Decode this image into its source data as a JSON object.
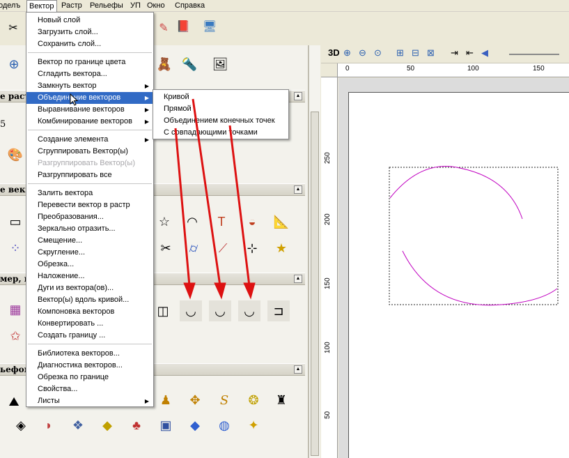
{
  "menubar": {
    "items": [
      "оделъ",
      "Вектор",
      "Растр",
      "Рельефы",
      "УП",
      "Окно",
      "Справка"
    ]
  },
  "vector_menu": {
    "items": [
      {
        "label": "Новый слой"
      },
      {
        "label": "Загрузить слой..."
      },
      {
        "label": "Сохранить слой..."
      },
      {
        "label": "Вектор по границе цвета"
      },
      {
        "label": "Сгладить вектора..."
      },
      {
        "label": "Замкнуть вектор"
      },
      {
        "label": "Объединение векторов",
        "highlighted": true
      },
      {
        "label": "Выравнивание векторов"
      },
      {
        "label": "Комбинирование векторов"
      },
      {
        "label": "Создание элемента"
      },
      {
        "label": "Сгруппировать Вектор(ы)"
      },
      {
        "label": "Разгруппировать Вектор(ы)",
        "disabled": true
      },
      {
        "label": "Разгруппировать все"
      },
      {
        "label": "Залить вектора"
      },
      {
        "label": "Перевести вектор в растр"
      },
      {
        "label": "Преобразования..."
      },
      {
        "label": "Зеркально отразить..."
      },
      {
        "label": "Смещение..."
      },
      {
        "label": "Скругление..."
      },
      {
        "label": "Обрезка..."
      },
      {
        "label": "Наложение..."
      },
      {
        "label": "Дуги из вектора(ов)..."
      },
      {
        "label": "Вектор(ы) вдоль кривой..."
      },
      {
        "label": "Компоновка векторов"
      },
      {
        "label": "Конвертировать ..."
      },
      {
        "label": "Создать границу ..."
      },
      {
        "label": "Библиотека векторов..."
      },
      {
        "label": "Диагностика векторов..."
      },
      {
        "label": "Обрезка по границе"
      },
      {
        "label": "Свойства..."
      },
      {
        "label": "Листы"
      }
    ]
  },
  "join_submenu": {
    "items": [
      "Кривой",
      "Прямой",
      "Объединением конечных точек",
      "С совпадающими точками"
    ]
  },
  "left_panel": {
    "sections": [
      "е раст",
      "е векто",
      "мер, п",
      "ьефом"
    ],
    "value_5": "5"
  },
  "canvas": {
    "mode_label": "3D",
    "ruler_h": [
      "0",
      "50",
      "100",
      "150"
    ],
    "ruler_v": [
      "250",
      "200",
      "150",
      "100",
      "50"
    ]
  },
  "colors": {
    "highlight": "#316ac5",
    "curve": "#c000c0",
    "arrow": "#dd1111"
  }
}
